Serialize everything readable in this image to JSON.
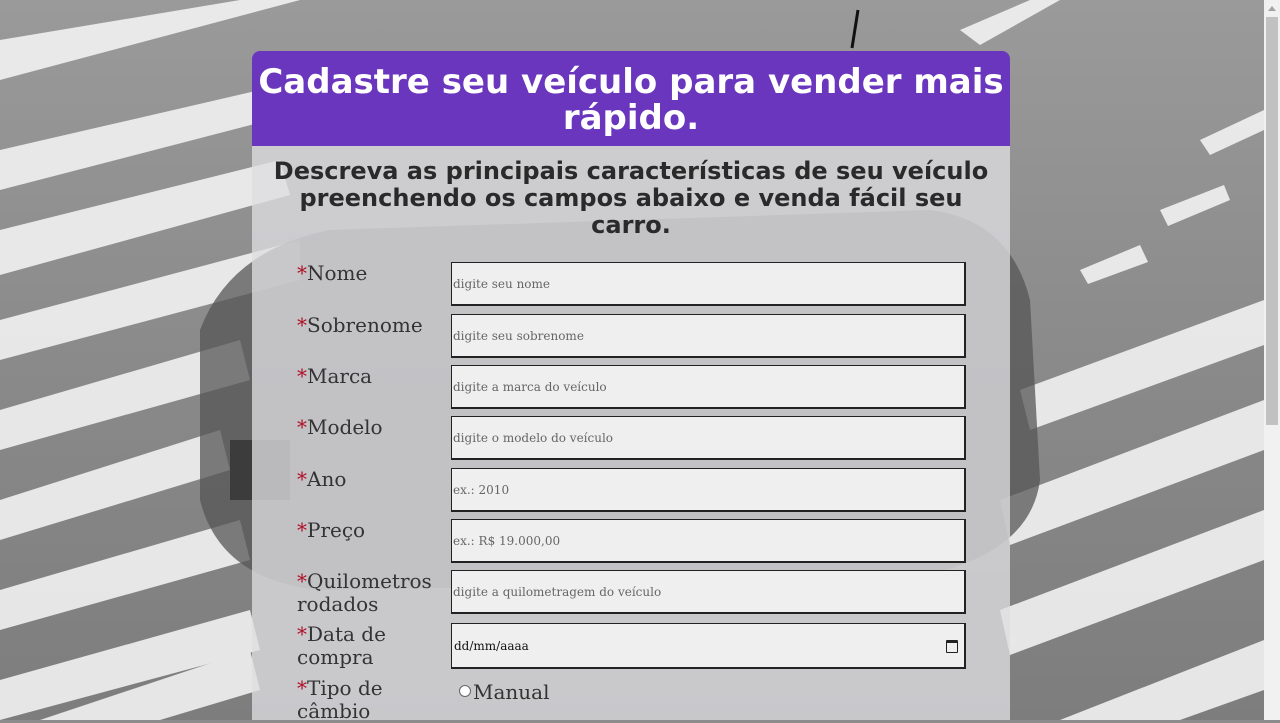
{
  "header": {
    "title": "Cadastre seu veículo para vender mais rápido."
  },
  "subtitle": "Descreva as principais características de seu veículo preenchendo os campos abaixo e venda fácil seu carro.",
  "required_marker": "*",
  "fields": {
    "nome": {
      "label": "Nome",
      "placeholder": "digite seu nome"
    },
    "sobrenome": {
      "label": "Sobrenome",
      "placeholder": "digite seu sobrenome"
    },
    "marca": {
      "label": "Marca",
      "placeholder": "digite a marca do veículo"
    },
    "modelo": {
      "label": "Modelo",
      "placeholder": "digite o modelo do veículo"
    },
    "ano": {
      "label": "Ano",
      "placeholder": "ex.: 2010"
    },
    "preco": {
      "label": "Preço",
      "placeholder": "ex.: R$ 19.000,00"
    },
    "quilometros": {
      "label": "Quilometros rodados",
      "placeholder": "digite a quilometragem do veículo"
    },
    "data_compra": {
      "label": "Data de compra",
      "value": "dd/mm/aaaa"
    },
    "cambio": {
      "label": "Tipo de câmbio",
      "options": [
        "Manual"
      ]
    }
  },
  "icons": {
    "calendar": "calendar-icon"
  },
  "colors": {
    "header_bg": "#6a36be",
    "required": "#b01028"
  }
}
